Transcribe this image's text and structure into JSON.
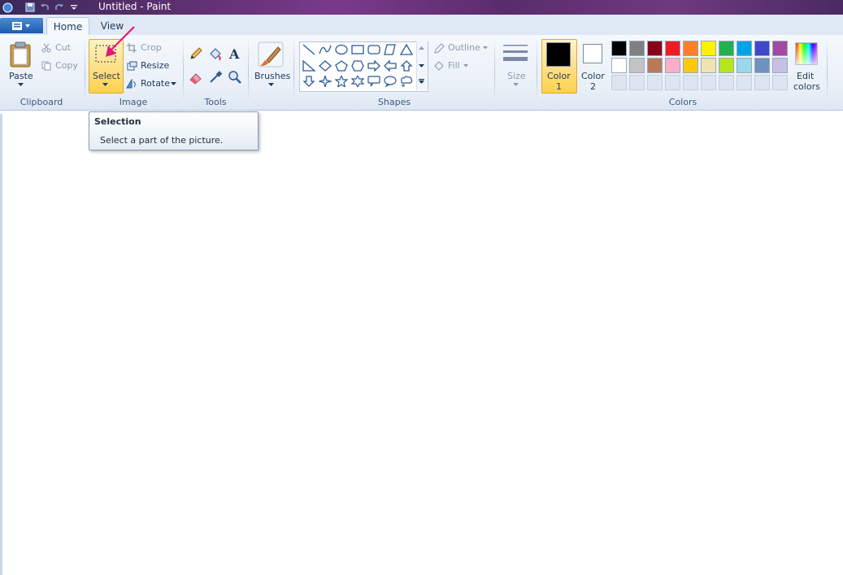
{
  "window": {
    "title": "Untitled - Paint"
  },
  "quick_access": [
    "save-icon",
    "undo-icon",
    "redo-icon",
    "customize-icon"
  ],
  "tabs": [
    {
      "label": "Home",
      "active": true
    },
    {
      "label": "View",
      "active": false
    }
  ],
  "clipboard": {
    "paste": "Paste",
    "cut": "Cut",
    "copy": "Copy",
    "group": "Clipboard"
  },
  "image": {
    "select": "Select",
    "crop": "Crop",
    "resize": "Resize",
    "rotate": "Rotate",
    "group": "Image"
  },
  "tools": {
    "group": "Tools"
  },
  "brushes": {
    "label": "Brushes"
  },
  "shapes": {
    "outline": "Outline",
    "fill": "Fill",
    "group": "Shapes"
  },
  "size": {
    "label": "Size"
  },
  "colors": {
    "color1_line1": "Color",
    "color1_line2": "1",
    "color2_line1": "Color",
    "color2_line2": "2",
    "edit_line1": "Edit",
    "edit_line2": "colors",
    "group": "Colors",
    "color1_value": "#000000",
    "color2_value": "#ffffff",
    "palette_row1": [
      "#000000",
      "#7f7f7f",
      "#880015",
      "#ed1c24",
      "#ff7f27",
      "#fff200",
      "#22b14c",
      "#00a2e8",
      "#3f48cc",
      "#a349a4"
    ],
    "palette_row2": [
      "#ffffff",
      "#c3c3c3",
      "#b97a57",
      "#ffaec9",
      "#ffc90e",
      "#efe4b0",
      "#b5e61d",
      "#99d9ea",
      "#7092be",
      "#c8bfe7"
    ]
  },
  "tooltip": {
    "title": "Selection",
    "description": "Select a part of the picture."
  }
}
